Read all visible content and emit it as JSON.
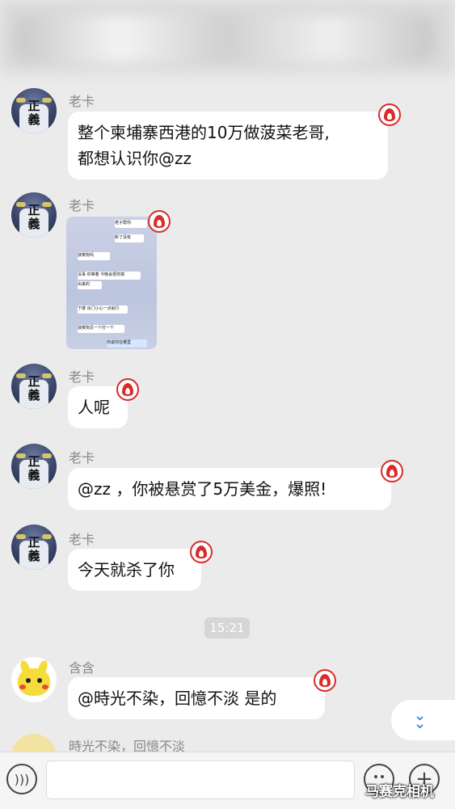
{
  "header": {
    "title_blurred": ""
  },
  "messages": [
    {
      "sender": "老卡",
      "text_lines": [
        "整个柬埔寨西港的10万做菠菜老哥,",
        "都想认识你@zz"
      ]
    },
    {
      "sender": "老卡",
      "image": {
        "lines": [
          "老子帮你",
          "新了没有",
          "菠菜狗吗",
          "没事 你等着 今晚会把你搞",
          "出来的",
          "下楼 出门小心一点就行",
          "菠菜狗见一个打一个",
          "你说你在哪里"
        ]
      }
    },
    {
      "sender": "老卡",
      "text_lines": [
        "人呢"
      ]
    },
    {
      "sender": "老卡",
      "text_lines": [
        "@zz ，你被悬赏了5万美金，爆照!"
      ]
    },
    {
      "sender": "老卡",
      "text_lines": [
        "今天就杀了你"
      ]
    },
    {
      "sender": "含含",
      "text_lines": [
        "@時光不染，回憶不淡  是的"
      ]
    }
  ],
  "timestamp": "15:21",
  "partial_sender": "時光不染，回憶不淡",
  "avatar_text": "正\n義",
  "bottom": {
    "input_placeholder": ""
  },
  "watermark": "马赛克相机",
  "colors": {
    "flame": "#d92b2b",
    "accent": "#2f8cf5",
    "bg": "#ebebeb"
  }
}
